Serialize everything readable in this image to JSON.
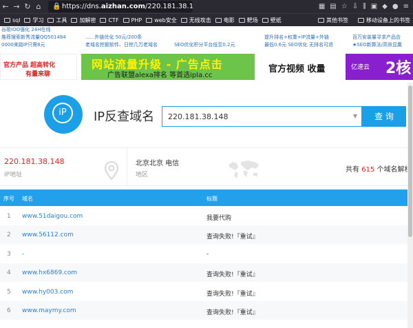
{
  "browser": {
    "url_prefix": "https://dns.",
    "url_domain": "aizhan.com",
    "url_path": "/220.181.38.148",
    "bookmarks": [
      {
        "label": "sql",
        "icon": "folder-icon"
      },
      {
        "label": "学习",
        "icon": "folder-icon"
      },
      {
        "label": "工具",
        "icon": "folder-icon"
      },
      {
        "label": "加解密",
        "icon": "folder-icon"
      },
      {
        "label": "CTF",
        "icon": "folder-icon"
      },
      {
        "label": "PHP",
        "icon": "folder-icon"
      },
      {
        "label": "web安全",
        "icon": "folder-icon"
      },
      {
        "label": "无线攻击",
        "icon": "folder-icon"
      },
      {
        "label": "电影",
        "icon": "folder-icon"
      },
      {
        "label": "靶场",
        "icon": "folder-icon"
      },
      {
        "label": "壁纸",
        "icon": "folder-icon"
      }
    ],
    "other_bookmarks": "其他书签",
    "mobile_bookmarks": "移动设备上的书签"
  },
  "ad_text": {
    "col1": [
      "谷歌IOO强化 24H在线",
      "推荐搜索新秀流量QQ501484",
      "0000来路IP只需8元"
    ],
    "col2": [
      "......外链优化 50元/200条",
      "老域名挖掘软件、日挖几万老域名"
    ],
    "col3": [
      "SEO优化积分平台低至0.2元"
    ],
    "col4": [
      "提升排名+权重+IP流量+外链",
      "最低0.6元 SEO优化 无排名可退"
    ],
    "col5": [
      "百万安装量寻求产品合",
      "★SEO新算法/高效显赢"
    ]
  },
  "banners": {
    "b1_line1": "官方产品  超高转化",
    "b1_line2": "有量来聊",
    "b2_line1": "网站流量升级 - 广告点击",
    "b2_line2": "广告联盟alexa排名 等首选ipla.cc",
    "b3_line1": "官方视频  收量",
    "b4_brand": "亿速云",
    "b4_big": "2核"
  },
  "search": {
    "logo_text": "iP",
    "title": "IP反查域名",
    "value": "220.181.38.148",
    "button": "查 询"
  },
  "info": {
    "ip": "220.181.38.148",
    "ip_label": "IP地址",
    "location": "北京北京 电信",
    "location_label": "地区",
    "count_prefix": "共有 ",
    "count_num": "615",
    "count_suffix": " 个域名解析"
  },
  "table": {
    "headers": [
      "序号",
      "域名",
      "标题"
    ],
    "rows": [
      {
        "n": "1",
        "domain": "www.51daigou.com",
        "title": "我要代购"
      },
      {
        "n": "2",
        "domain": "www.56112.com",
        "title": "查询失败!『重试』"
      },
      {
        "n": "3",
        "domain": "-",
        "title": "-"
      },
      {
        "n": "4",
        "domain": "www.hx6869.com",
        "title": "查询失败!『重试』"
      },
      {
        "n": "5",
        "domain": "www.hy003.com",
        "title": "查询失败!『重试』"
      },
      {
        "n": "6",
        "domain": "www.maymy.com",
        "title": "查询失败!『重试』"
      }
    ]
  },
  "colors": {
    "accent": "#1ba0e8",
    "header_bg": "#22a0eb",
    "red": "#e02323",
    "link": "#2a7fd4"
  }
}
